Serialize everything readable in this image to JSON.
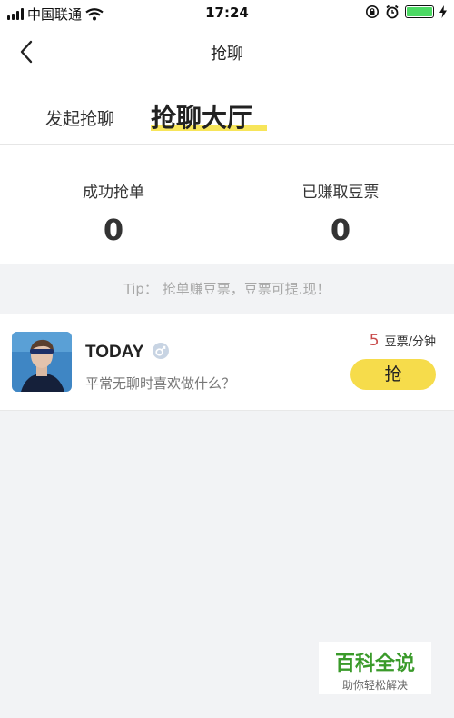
{
  "status_bar": {
    "carrier": "中国联通",
    "time": "17:24"
  },
  "nav": {
    "title": "抢聊"
  },
  "tabs": [
    {
      "label": "发起抢聊",
      "active": false
    },
    {
      "label": "抢聊大厅",
      "active": true
    }
  ],
  "stats": [
    {
      "label": "成功抢单",
      "value": "0"
    },
    {
      "label": "已赚取豆票",
      "value": "0"
    }
  ],
  "tip": "Tip： 抢单赚豆票，豆票可提.现！",
  "listing": {
    "name": "TODAY",
    "gender_icon": "male-icon",
    "message": "平常无聊时喜欢做什么？",
    "price": "5",
    "price_unit": "豆票/分钟",
    "button": "抢"
  },
  "watermark": {
    "title": "百科全说",
    "subtitle": "助你轻松解决"
  },
  "colors": {
    "accent_yellow": "#f6dc4b",
    "price_red": "#c84a4a",
    "battery_green": "#4cd964",
    "watermark_green": "#3a9a2a"
  }
}
